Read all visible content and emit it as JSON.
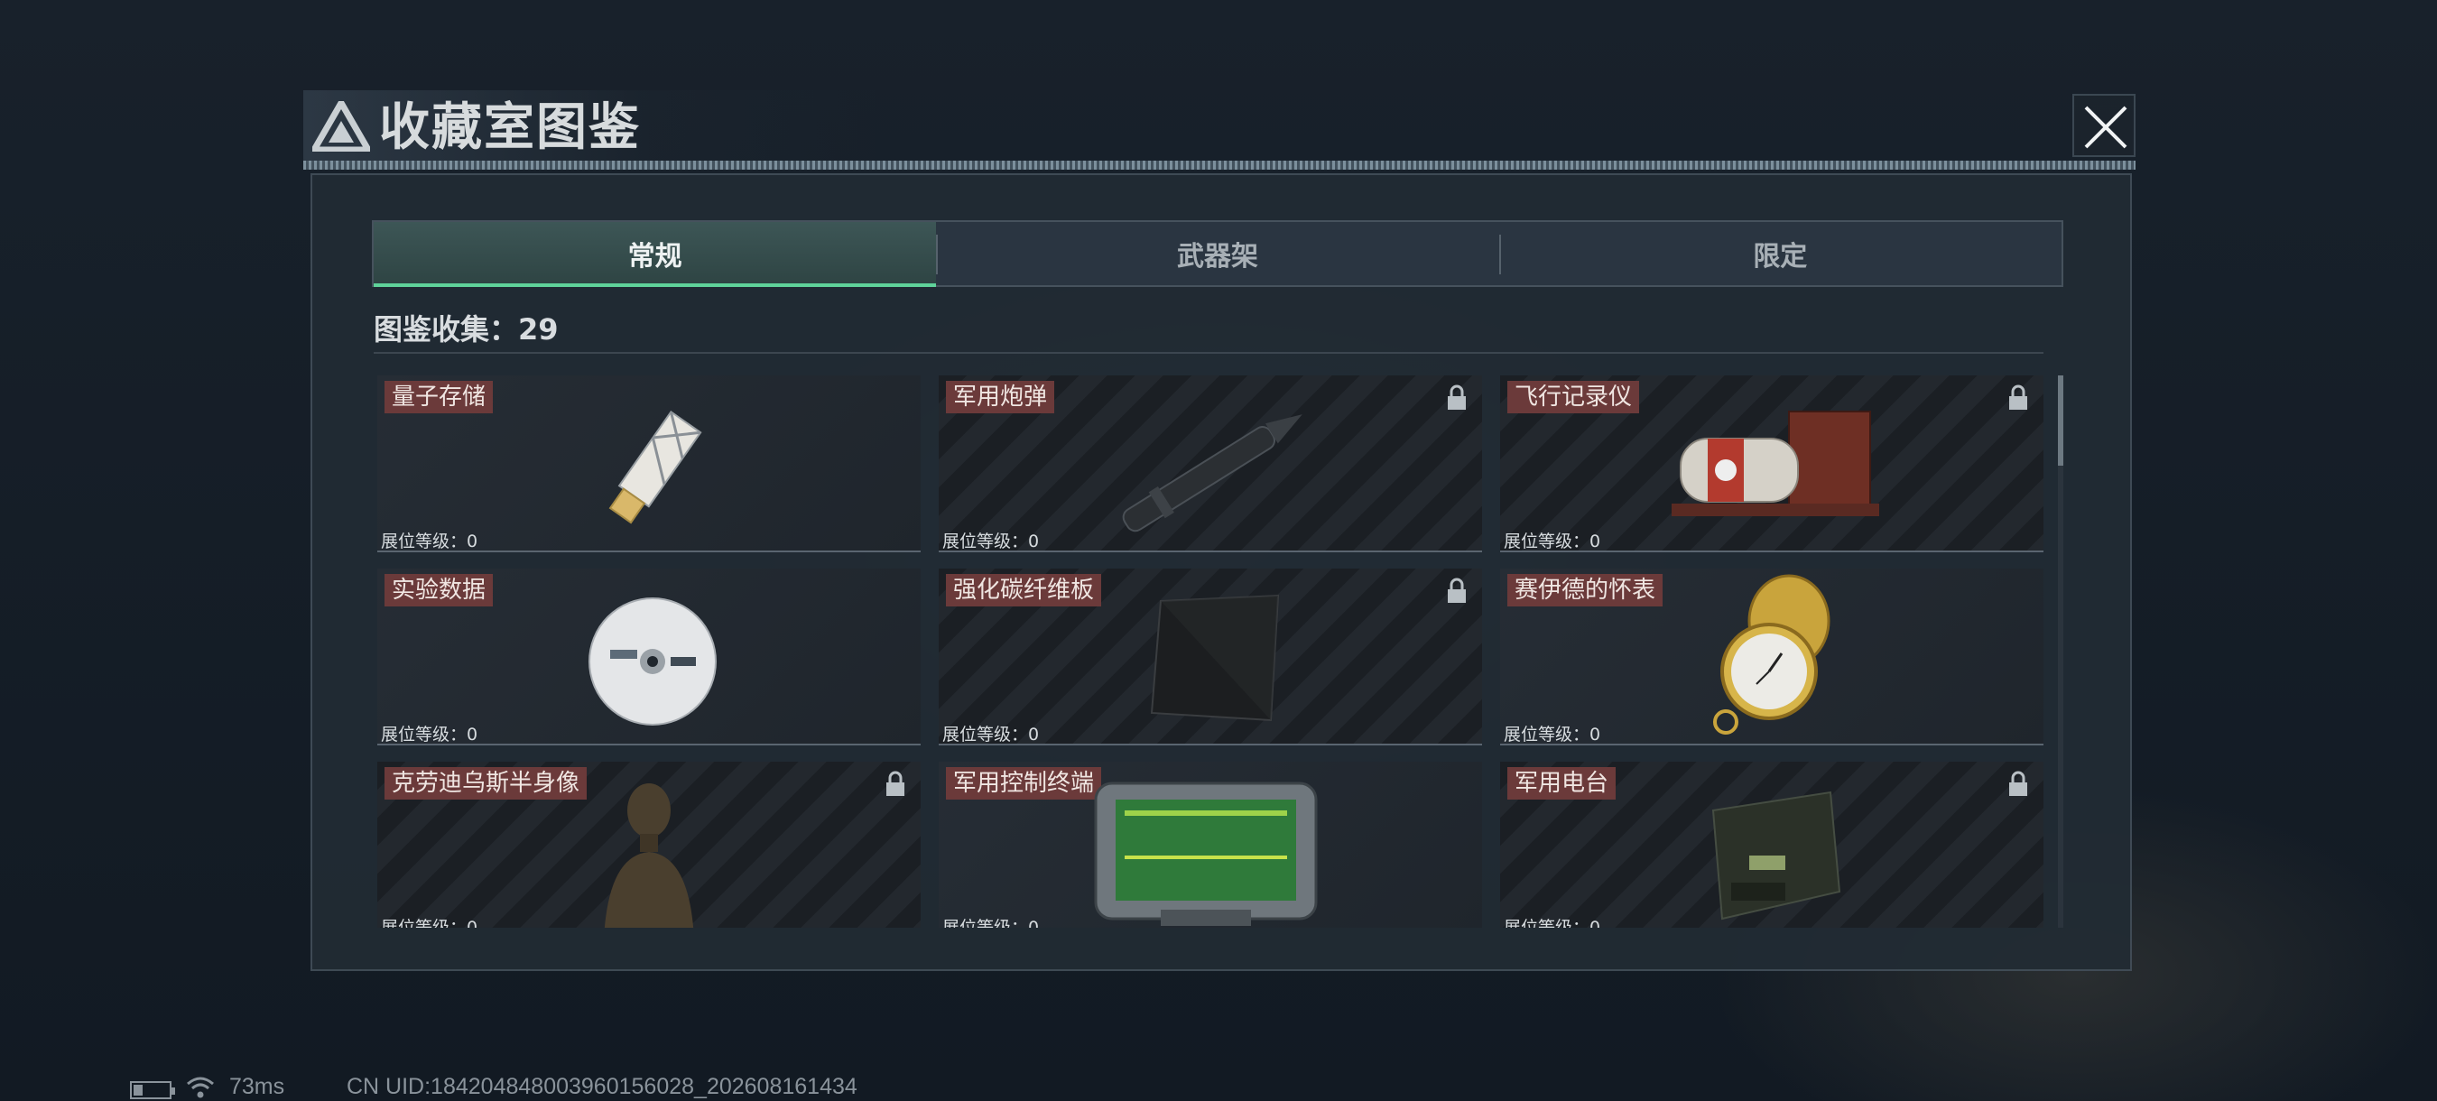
{
  "header": {
    "title": "收藏室图鉴"
  },
  "tabs": [
    {
      "label": "常规",
      "active": true
    },
    {
      "label": "武器架",
      "active": false
    },
    {
      "label": "限定",
      "active": false
    }
  ],
  "collection": {
    "text": "图鉴收集：29"
  },
  "level_label": "展位等级：0",
  "items": [
    {
      "name": "量子存储",
      "locked": false,
      "icon": "usb-drive-icon"
    },
    {
      "name": "军用炮弹",
      "locked": true,
      "icon": "artillery-shell-icon"
    },
    {
      "name": "飞行记录仪",
      "locked": true,
      "icon": "flight-recorder-icon"
    },
    {
      "name": "实验数据",
      "locked": false,
      "icon": "disc-icon"
    },
    {
      "name": "强化碳纤维板",
      "locked": true,
      "icon": "carbon-plate-icon"
    },
    {
      "name": "赛伊德的怀表",
      "locked": false,
      "icon": "pocket-watch-icon"
    },
    {
      "name": "克劳迪乌斯半身像",
      "locked": true,
      "icon": "bust-statue-icon"
    },
    {
      "name": "军用控制终端",
      "locked": false,
      "icon": "control-terminal-icon"
    },
    {
      "name": "军用电台",
      "locked": true,
      "icon": "military-radio-icon"
    }
  ],
  "status": {
    "ping": "73ms",
    "uid": "CN UID:18420484800396015​6028_202608161434"
  },
  "colors": {
    "accent": "#5fd39a",
    "name_tag": "#6b3a3a"
  }
}
